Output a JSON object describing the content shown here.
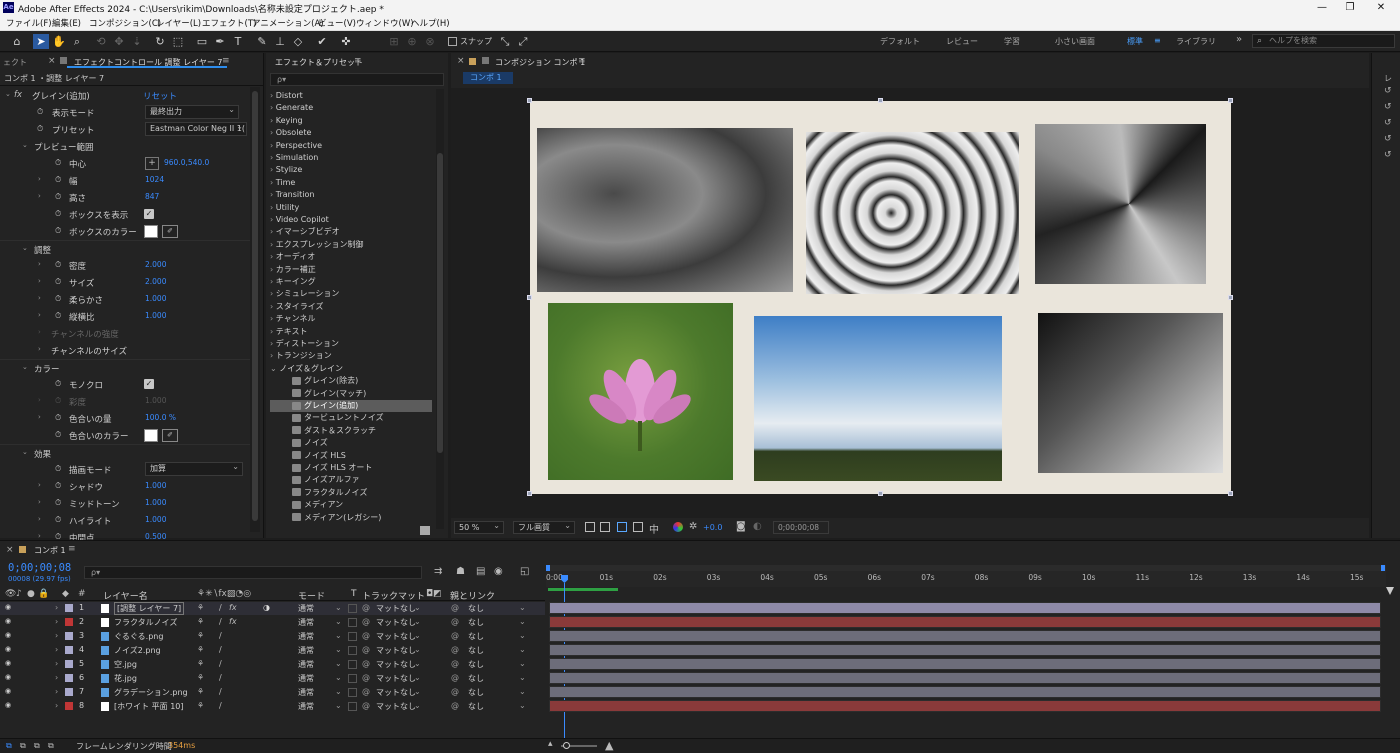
{
  "titlebar": {
    "app_logo": "Ae",
    "title": "Adobe After Effects 2024 - C:\\Users\\rikim\\Downloads\\名称未設定プロジェクト.aep *",
    "minimize": "—",
    "maximize": "❐",
    "close": "✕"
  },
  "menu": [
    "ファイル(F)",
    "編集(E)",
    "コンポジション(C)",
    "レイヤー(L)",
    "エフェクト(T)",
    "アニメーション(A)",
    "ビュー(V)",
    "ウィンドウ(W)",
    "ヘルプ(H)"
  ],
  "toolbar": {
    "snap_label": "スナップ",
    "workspaces": [
      "デフォルト",
      "レビュー",
      "学習",
      "小さい画面",
      "標準",
      "ライブラリ"
    ],
    "active_workspace": "標準",
    "help_placeholder": "ヘルプを検索"
  },
  "effect_controls": {
    "tab_left": "ェクト",
    "tab": "エフェクトコントロール 調整 レイヤー 7",
    "header": "コンポ 1 ・調整 レイヤー 7",
    "effect_name": "グレイン(追加)",
    "reset": "リセット",
    "rows": {
      "display_mode": {
        "label": "表示モード",
        "value": "最終出力"
      },
      "preset": {
        "label": "プリセット",
        "value": "Eastman Color Neg II 1("
      },
      "preview_area": "プレビュー範囲",
      "center": {
        "label": "中心",
        "value": "960.0,540.0"
      },
      "width": {
        "label": "幅",
        "value": "1024"
      },
      "height": {
        "label": "高さ",
        "value": "847"
      },
      "show_box": {
        "label": "ボックスを表示"
      },
      "box_color": {
        "label": "ボックスのカラー"
      },
      "tweak": "調整",
      "intensity": {
        "label": "密度",
        "value": "2.000"
      },
      "size": {
        "label": "サイズ",
        "value": "2.000"
      },
      "softness": {
        "label": "柔らかさ",
        "value": "1.000"
      },
      "aspect": {
        "label": "縦横比",
        "value": "1.000"
      },
      "channel_intensity": "チャンネルの強度",
      "channel_size": "チャンネルのサイズ",
      "color": "カラー",
      "mono": {
        "label": "モノクロ"
      },
      "saturation": {
        "label": "彩度",
        "value": "1.000"
      },
      "tint_amount": {
        "label": "色合いの量",
        "value": "100.0 %"
      },
      "tint_color": {
        "label": "色合いのカラー"
      },
      "application": "効果",
      "blend_mode": {
        "label": "描画モード",
        "value": "加算"
      },
      "shadows": {
        "label": "シャドウ",
        "value": "1.000"
      },
      "midtones": {
        "label": "ミッドトーン",
        "value": "1.000"
      },
      "highlights": {
        "label": "ハイライト",
        "value": "1.000"
      },
      "midpoint": {
        "label": "中間点",
        "value": "0.500"
      }
    }
  },
  "effects_presets": {
    "tab": "エフェクト＆プリセット",
    "search_placeholder": "ρ▾",
    "categories": [
      "Distort",
      "Generate",
      "Keying",
      "Obsolete",
      "Perspective",
      "Simulation",
      "Stylize",
      "Time",
      "Transition",
      "Utility",
      "Video Copilot",
      "イマーシブビデオ",
      "エクスプレッション制御",
      "オーディオ",
      "カラー補正",
      "キーイング",
      "シミュレーション",
      "スタイライズ",
      "チャンネル",
      "テキスト",
      "ディストーション",
      "トランジション"
    ],
    "open_category": "ノイズ＆グレイン",
    "open_items": [
      "グレイン(除去)",
      "グレイン(マッチ)",
      "グレイン(追加)",
      "タービュレントノイズ",
      "ダスト＆スクラッチ",
      "ノイズ",
      "ノイズ HLS",
      "ノイズ HLS オート",
      "ノイズアルファ",
      "フラクタルノイズ",
      "メディアン",
      "メディアン(レガシー)"
    ],
    "selected": "グレイン(追加)"
  },
  "composition": {
    "tab": "コンポジション コンポ 1",
    "subtab": "コンポ 1",
    "zoom": "50 %",
    "resolution": "フル画質",
    "exposure": "+0.0",
    "timecode": "0;00;00;08"
  },
  "timeline": {
    "tab": "コンポ 1",
    "timecode": "0;00;00;08",
    "frame_info": "00008 (29.97 fps)",
    "search_placeholder": "ρ▾",
    "columns": {
      "layer_name": "レイヤー名",
      "mode": "モード",
      "t": "T",
      "track_matte": "トラックマット",
      "parent": "親とリンク"
    },
    "layers": [
      {
        "num": "1",
        "name": "[調整 レイヤー 7]",
        "color": "#a9a9cc",
        "mode": "通常",
        "matte": "マットなし",
        "parent": "なし",
        "bar": "#8e8aa8"
      },
      {
        "num": "2",
        "name": "フラクタルノイズ",
        "color": "#c03636",
        "mode": "通常",
        "matte": "マットなし",
        "parent": "なし",
        "bar": "#8a3a3a"
      },
      {
        "num": "3",
        "name": "ぐるぐる.png",
        "color": "#a9a9cc",
        "mode": "通常",
        "matte": "マットなし",
        "parent": "なし",
        "bar": "#6d6d7a"
      },
      {
        "num": "4",
        "name": "ノイズ2.png",
        "color": "#a9a9cc",
        "mode": "通常",
        "matte": "マットなし",
        "parent": "なし",
        "bar": "#6d6d7a"
      },
      {
        "num": "5",
        "name": "空.jpg",
        "color": "#a9a9cc",
        "mode": "通常",
        "matte": "マットなし",
        "parent": "なし",
        "bar": "#6d6d7a"
      },
      {
        "num": "6",
        "name": "花.jpg",
        "color": "#a9a9cc",
        "mode": "通常",
        "matte": "マットなし",
        "parent": "なし",
        "bar": "#6d6d7a"
      },
      {
        "num": "7",
        "name": "グラデーション.png",
        "color": "#a9a9cc",
        "mode": "通常",
        "matte": "マットなし",
        "parent": "なし",
        "bar": "#6d6d7a"
      },
      {
        "num": "8",
        "name": "[ホワイト 平面 10]",
        "color": "#c03636",
        "mode": "通常",
        "matte": "マットなし",
        "parent": "なし",
        "bar": "#8a3a3a"
      }
    ],
    "ruler": [
      "0:00s",
      "01s",
      "02s",
      "03s",
      "04s",
      "05s",
      "06s",
      "07s",
      "08s",
      "09s",
      "10s",
      "11s",
      "12s",
      "13s",
      "14s",
      "15s"
    ],
    "render_label": "フレームレンダリング時間",
    "render_time": "354ms"
  }
}
